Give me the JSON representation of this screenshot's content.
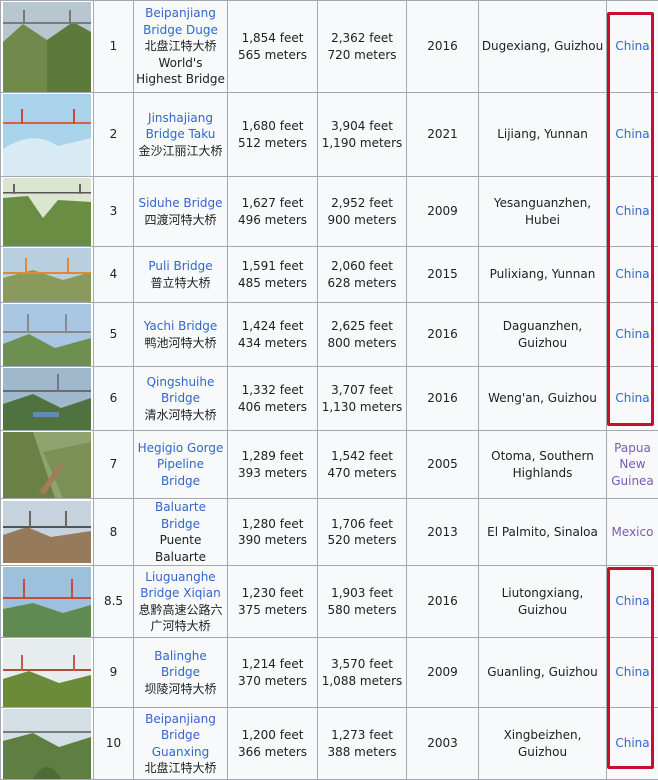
{
  "rows": [
    {
      "rank": "1",
      "name": "Beipanjiang Bridge Duge",
      "local_name": "北盘江特大桥",
      "note": "World's Highest Bridge",
      "height_ft": "1,854 feet",
      "height_m": "565 meters",
      "span_ft": "2,362 feet",
      "span_m": "720 meters",
      "year": "2016",
      "location": "Dugexiang, Guizhou",
      "country": "China"
    },
    {
      "rank": "2",
      "name": "Jinshajiang Bridge Taku",
      "local_name": "金沙江丽江大桥",
      "note": "",
      "height_ft": "1,680 feet",
      "height_m": "512 meters",
      "span_ft": "3,904 feet",
      "span_m": "1,190 meters",
      "year": "2021",
      "location": "Lijiang, Yunnan",
      "country": "China"
    },
    {
      "rank": "3",
      "name": "Siduhe Bridge",
      "local_name": "四渡河特大桥",
      "note": "",
      "height_ft": "1,627 feet",
      "height_m": "496 meters",
      "span_ft": "2,952 feet",
      "span_m": "900 meters",
      "year": "2009",
      "location": "Yesanguanzhen, Hubei",
      "country": "China"
    },
    {
      "rank": "4",
      "name": "Puli Bridge",
      "local_name": "普立特大桥",
      "note": "",
      "height_ft": "1,591 feet",
      "height_m": "485 meters",
      "span_ft": "2,060 feet",
      "span_m": "628 meters",
      "year": "2015",
      "location": "Pulixiang, Yunnan",
      "country": "China"
    },
    {
      "rank": "5",
      "name": "Yachi Bridge",
      "local_name": "鸭池河特大桥",
      "note": "",
      "height_ft": "1,424 feet",
      "height_m": "434 meters",
      "span_ft": "2,625 feet",
      "span_m": "800 meters",
      "year": "2016",
      "location": "Daguanzhen, Guizhou",
      "country": "China"
    },
    {
      "rank": "6",
      "name": "Qingshuihe Bridge",
      "local_name": "清水河特大桥",
      "note": "",
      "height_ft": "1,332 feet",
      "height_m": "406 meters",
      "span_ft": "3,707 feet",
      "span_m": "1,130 meters",
      "year": "2016",
      "location": "Weng'an, Guizhou",
      "country": "China"
    },
    {
      "rank": "7",
      "name": "Hegigio Gorge Pipeline Bridge",
      "local_name": "",
      "note": "",
      "height_ft": "1,289 feet",
      "height_m": "393 meters",
      "span_ft": "1,542 feet",
      "span_m": "470 meters",
      "year": "2005",
      "location": "Otoma, Southern Highlands",
      "country": "Papua New Guinea"
    },
    {
      "rank": "8",
      "name": "Baluarte Bridge",
      "local_name": "Puente Baluarte",
      "note": "",
      "height_ft": "1,280 feet",
      "height_m": "390 meters",
      "span_ft": "1,706 feet",
      "span_m": "520 meters",
      "year": "2013",
      "location": "El Palmito, Sinaloa",
      "country": "Mexico"
    },
    {
      "rank": "8.5",
      "name": "Liuguanghe Bridge Xiqian",
      "local_name": "息黔高速公路六广河特大桥",
      "note": "",
      "height_ft": "1,230 feet",
      "height_m": "375 meters",
      "span_ft": "1,903 feet",
      "span_m": "580 meters",
      "year": "2016",
      "location": "Liutongxiang, Guizhou",
      "country": "China"
    },
    {
      "rank": "9",
      "name": "Balinghe Bridge",
      "local_name": "坝陵河特大桥",
      "note": "",
      "height_ft": "1,214 feet",
      "height_m": "370 meters",
      "span_ft": "3,570 feet",
      "span_m": "1,088 meters",
      "year": "2009",
      "location": "Guanling, Guizhou",
      "country": "China"
    },
    {
      "rank": "10",
      "name": "Beipanjiang Bridge Guanxing",
      "local_name": "北盘江特大桥",
      "note": "",
      "height_ft": "1,200 feet",
      "height_m": "366 meters",
      "span_ft": "1,273 feet",
      "span_m": "388 meters",
      "year": "2003",
      "location": "Xingbeizhen, Guizhou",
      "country": "China"
    }
  ],
  "colors": {
    "link": "#3366cc",
    "visited_link": "#795cb2",
    "highlight": "#c8102e",
    "cell_bg": "#f8f9fa",
    "border": "#a2a9b1"
  }
}
